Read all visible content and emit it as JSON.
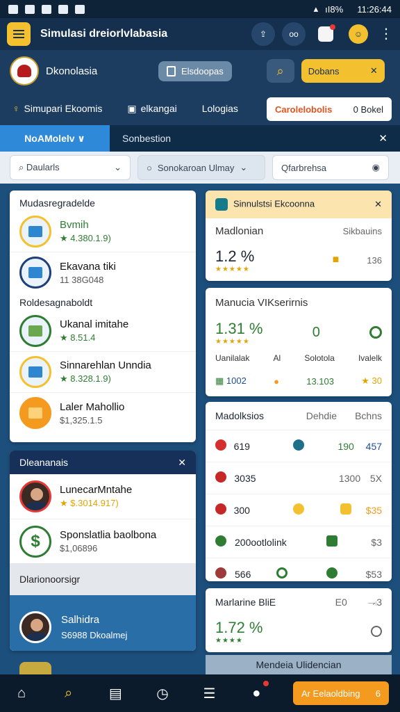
{
  "status": {
    "right": "ıI8%   11:26:44"
  },
  "header": {
    "title": "Simulasi dreiorlvlabasia",
    "btn2_label": "oo"
  },
  "brand": {
    "name": "Dkonolasia",
    "pill_label": "Elsdoopas",
    "yellow_label": "Dobans"
  },
  "nav": {
    "items": [
      "Simupari Ekoomis",
      "elkangai",
      "Lologias"
    ],
    "card_red": "Carolelobolis",
    "card_right": "0 Bokel"
  },
  "tabs": {
    "active": "NoAMolelv ∨",
    "second": "Sonbestion"
  },
  "filters": {
    "f1": "Daularls",
    "f2": "Sonokaroan Ulmay",
    "f3": "Qfarbrehsa"
  },
  "left_list": {
    "head1": "Mudasregradelde",
    "items1": [
      {
        "title": "Bvmih",
        "sub": "★ 4.380.1.9)",
        "color": "green"
      },
      {
        "title": "Ekavana tiki",
        "sub": "11 38G048",
        "color": "gray"
      }
    ],
    "head2": "Roldesagnaboldt",
    "items2": [
      {
        "title": "Ukanal imitahe",
        "sub": "★ 8.51.4"
      },
      {
        "title": "Sinnarehlan Unndia",
        "sub": "★ 8.328.1.9)"
      },
      {
        "title": "Laler Mahollio",
        "sub": "$1,325.1.5"
      }
    ]
  },
  "left_dark": {
    "title": "Dleananais",
    "items": [
      {
        "title": "LunecarMntahe",
        "sub": "★ $.3014.917)"
      },
      {
        "title": "Sponslatlia baolbona",
        "sub": "$1,06896"
      }
    ],
    "strip": "Dlarionoorsigr",
    "profile_title": "Salhidra",
    "profile_sub": "S6988 Dkoalmej"
  },
  "card1": {
    "head": "Sinnulstsi Ekcoonna",
    "label": "Madlonian",
    "right_label": "Sikbauins",
    "pct": "1.2 %",
    "stars": "★★★★★",
    "value": "136"
  },
  "card2": {
    "title": "Manucia VIKserirnis",
    "pct": "1.31 %",
    "stars": "★★★★★",
    "mid": "0",
    "labels": [
      "Uanilalak",
      "Al",
      "Solotola",
      "Ivalelk"
    ],
    "values": [
      "1002",
      "13.103",
      "★ 30"
    ]
  },
  "card3": {
    "headers": [
      "Madolksios",
      "Dehdie",
      "Bchns"
    ],
    "rows": [
      {
        "c1": "619",
        "c3": "190",
        "c4": "457",
        "dot": "#d32f2f"
      },
      {
        "c1": "3035",
        "c3": "1300",
        "c4": "5X",
        "dot": "#c62828"
      },
      {
        "c1": "300",
        "c3": "",
        "c4": "$35",
        "dot": "#c62828"
      },
      {
        "c1": "200ootlolink",
        "c3": "",
        "c4": "$3",
        "dot": "#2e7d32"
      },
      {
        "c1": "566",
        "c3": "",
        "c4": "$53",
        "dot": "#2e7d32"
      }
    ]
  },
  "card4": {
    "title": "Marlarine BliE",
    "e": "E0",
    "r": "⥗3",
    "pct": "1.72 %",
    "stars": "★★★★"
  },
  "ghost": {
    "label": "Mendeia Ulidencian"
  },
  "bottom": {
    "pill": "Ar Eelaoldbing",
    "pill_num": "6"
  },
  "colors": {
    "accent": "#f3c130",
    "primary": "#14304e",
    "tab_active": "#2e8ad8"
  }
}
